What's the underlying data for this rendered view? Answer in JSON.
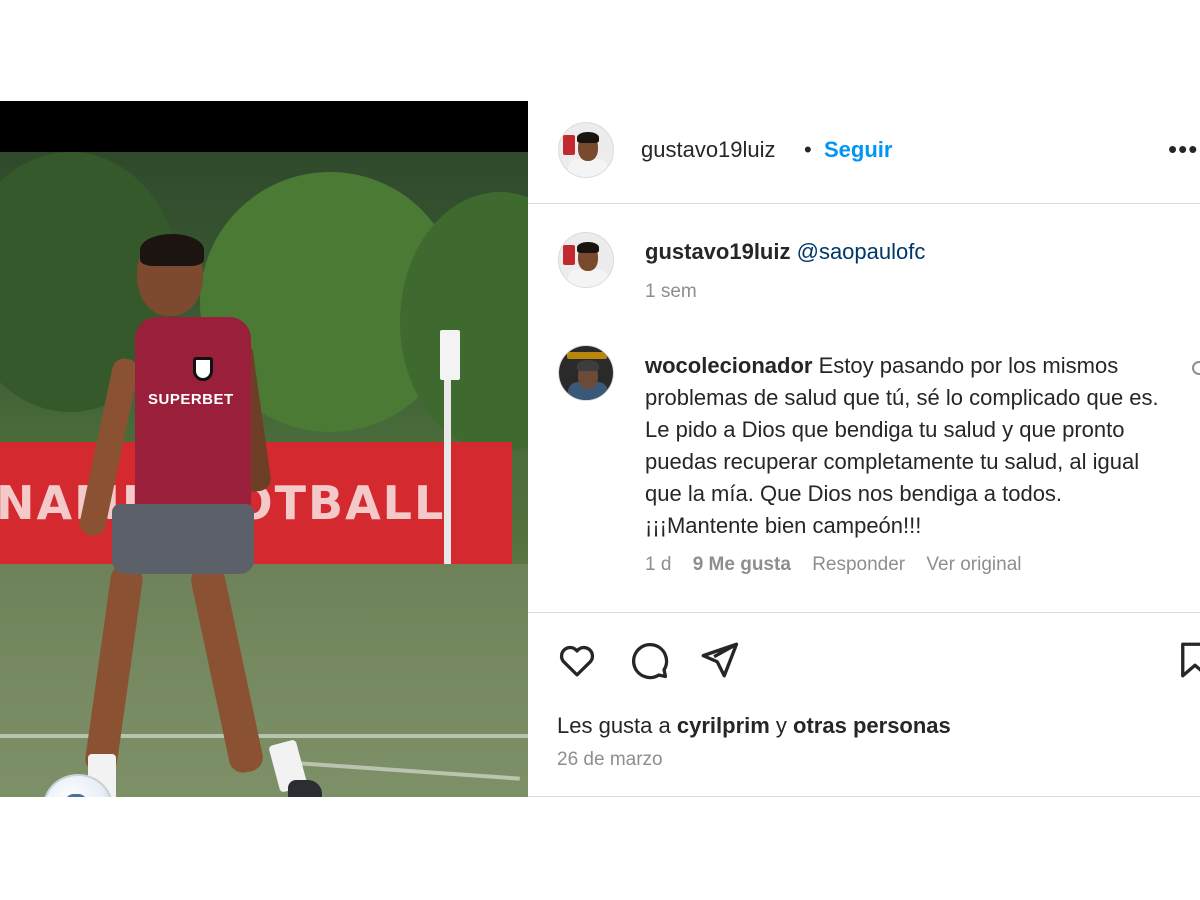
{
  "post": {
    "author": "gustavo19luiz",
    "separator": "•",
    "follow_label": "Seguir",
    "more_label": "•••",
    "caption": {
      "author": "gustavo19luiz",
      "mention": "@saopaulofc",
      "time": "1 sem"
    },
    "photo": {
      "banner_text": "NAMI  FOOTBALL",
      "jersey_text": "SUPERBET"
    }
  },
  "comment": {
    "author": "wocolecionador",
    "text": "Estoy pasando por los mismos problemas de salud que tú, sé lo complicado que es. Le pido a Dios que bendiga tu salud y que pronto puedas recuperar completamente tu salud, al igual que la mía. Que Dios nos bendiga a todos. ¡¡¡Mantente bien campeón!!!",
    "time": "1 d",
    "likes": "9 Me gusta",
    "reply_label": "Responder",
    "original_label": "Ver original"
  },
  "actions": {
    "like_icon": "heart-icon",
    "comment_icon": "comment-icon",
    "share_icon": "send-icon",
    "save_icon": "bookmark-icon"
  },
  "likes_line": {
    "prefix": "Les gusta a ",
    "user": "cyrilprim",
    "middle": " y ",
    "others": "otras personas"
  },
  "date": "26 de marzo",
  "colors": {
    "link_blue": "#0095f6",
    "mention": "#00376b",
    "muted": "#8e8e8e",
    "border": "#dbdbdb"
  }
}
